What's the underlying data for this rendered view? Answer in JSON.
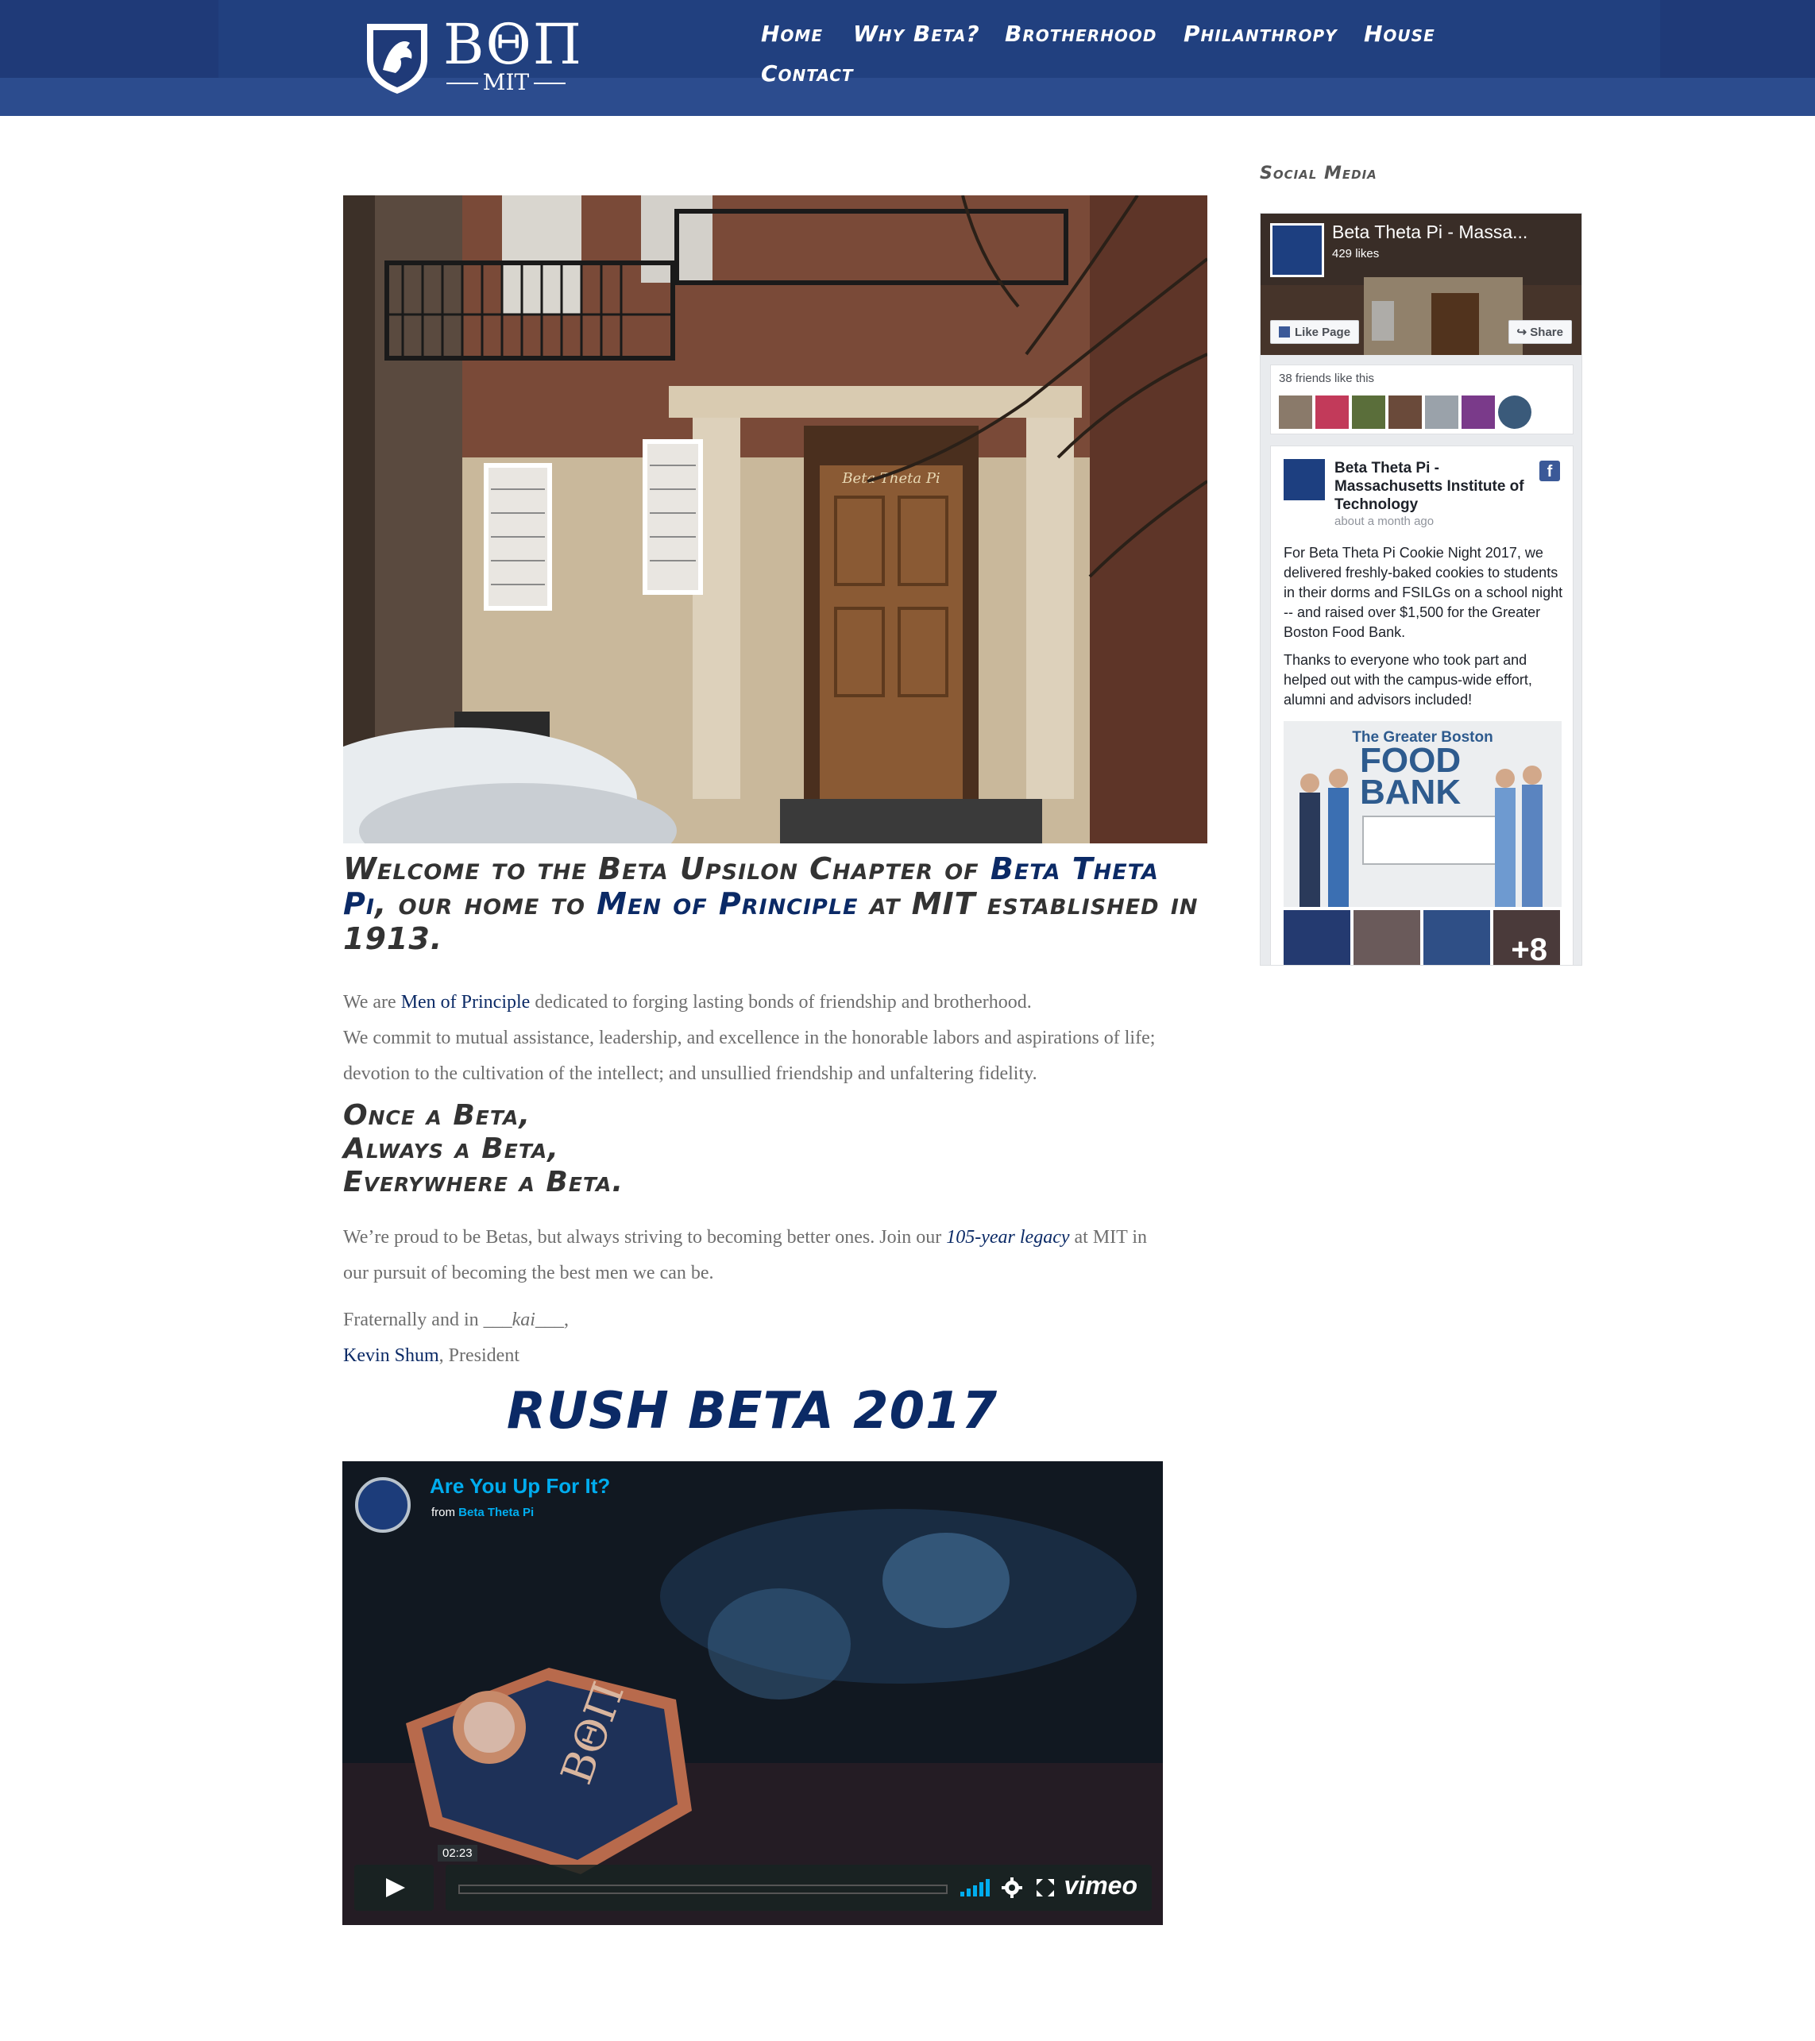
{
  "header": {
    "logo": {
      "letters": "ΒΘΠ",
      "subtitle": "MIT"
    },
    "nav": [
      "Home",
      "Why Beta?",
      "Brotherhood",
      "Philanthropy",
      "House",
      "Contact"
    ]
  },
  "hero_image": {
    "sign": "Beta Theta Pi"
  },
  "welcome": {
    "part1": "Welcome to the Beta Upsilon Chapter of ",
    "link1": "Beta Theta Pi",
    "part2": ", our home to ",
    "link2": "Men of Principle",
    "part3": " at MIT established in 1913."
  },
  "intro": {
    "p1_prefix": "We are ",
    "p1_link": "Men of Principle",
    "p1_suffix": " dedicated to forging lasting bonds of friendship and brotherhood.",
    "p2": "We commit to mutual assistance, leadership, and excellence in the honorable labors and aspirations of life; devotion to the cultivation of the intellect; and unsullied friendship and unfaltering fidelity."
  },
  "motto": [
    "Once a Beta,",
    "Always a Beta,",
    "Everywhere a Beta."
  ],
  "proud": {
    "prefix": "We’re proud to be Betas, but always striving to becoming better ones. Join our ",
    "link": "105-year legacy",
    "suffix": " at MIT in our pursuit of becoming the best men we can be."
  },
  "signoff": {
    "prefix": "Fraternally and in ",
    "kai": "___kai___",
    "suffix": ",",
    "name": "Kevin Shum",
    "role": ", President"
  },
  "rush": {
    "title": "RUSH BETA 2017"
  },
  "video": {
    "title": "Are You Up For It?",
    "from_prefix": "from ",
    "from_link": "Beta Theta Pi",
    "time": "02:23",
    "brand": "vimeo",
    "progress": 0
  },
  "sidebar": {
    "title": "Social Media",
    "facebook": {
      "page_name": "Beta Theta Pi - Massa...",
      "likes": "429 likes",
      "like_button": "Like Page",
      "share_button": "Share",
      "friends_text": "38 friends like this",
      "post": {
        "author": "Beta Theta Pi - Massachusetts Institute of Technology",
        "time": "about a month ago",
        "paragraph1": "For Beta Theta Pi Cookie Night 2017, we delivered freshly-baked cookies to students in their dorms and FSILGs on a school night -- and raised over $1,500 for the Greater Boston Food Bank.",
        "paragraph2": "Thanks to everyone who took part and helped out with the campus-wide effort, alumni and advisors included!",
        "image_title": "The Greater Boston",
        "image_big": "FOOD BANK",
        "more_photos": "+8"
      }
    }
  },
  "colors": {
    "header": "#1f3a78",
    "navy": "#0b2a66",
    "text": "#6e6e6e",
    "vimeo_blue": "#00adef",
    "facebook_blue": "#3b5998"
  }
}
